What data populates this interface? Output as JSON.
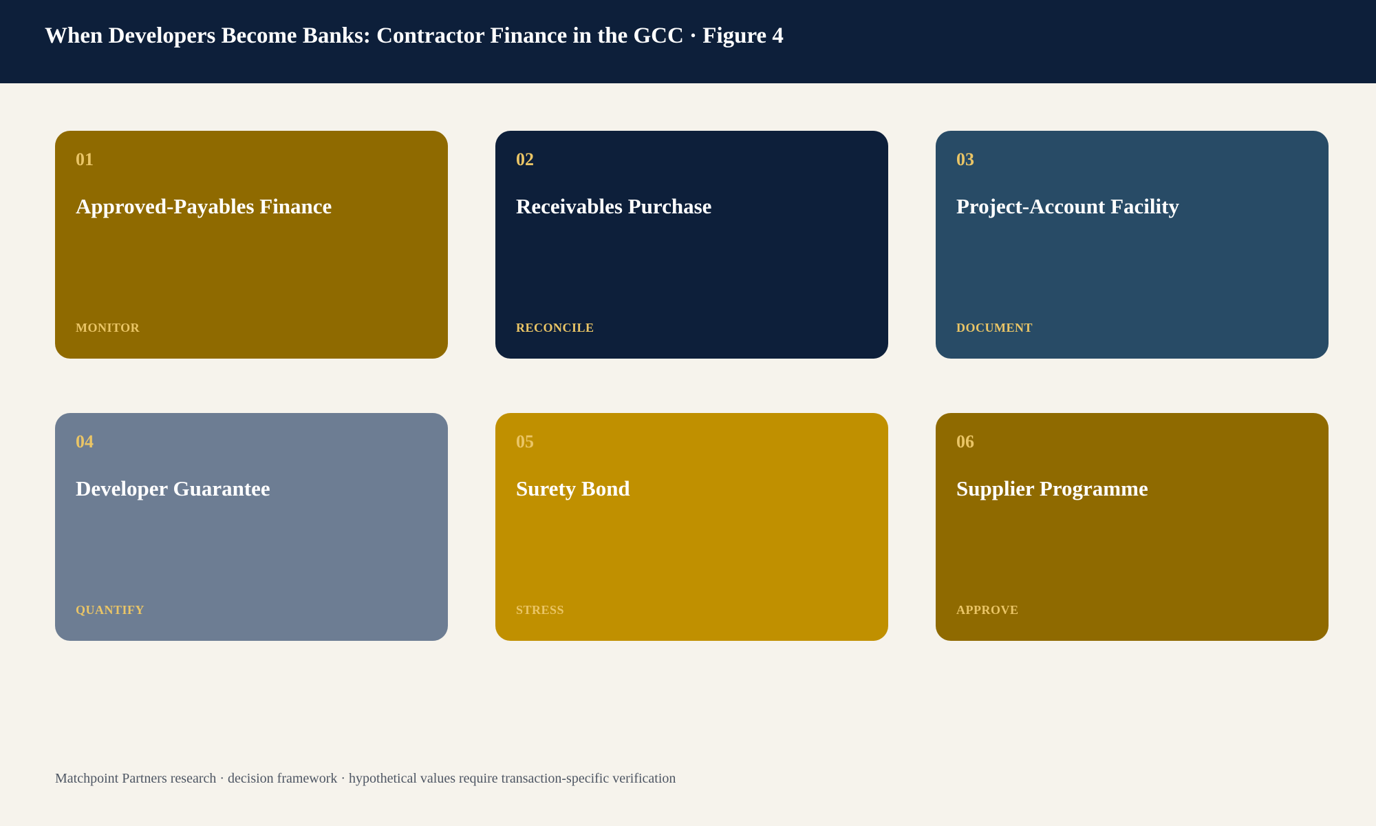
{
  "header": {
    "title": "When Developers Become Banks: Contractor Finance in the GCC · Figure 4",
    "background": "#0D1F3A"
  },
  "cards": [
    {
      "number": "01",
      "title": "Approved-Payables Finance",
      "tag": "MONITOR",
      "color": "#8F6A00"
    },
    {
      "number": "02",
      "title": "Receivables Purchase",
      "tag": "RECONCILE",
      "color": "#0D1F3A"
    },
    {
      "number": "03",
      "title": "Project-Account Facility",
      "tag": "DOCUMENT",
      "color": "#284B66"
    },
    {
      "number": "04",
      "title": "Developer Guarantee",
      "tag": "QUANTIFY",
      "color": "#6D7D93"
    },
    {
      "number": "05",
      "title": "Surety Bond",
      "tag": "STRESS",
      "color": "#C09000"
    },
    {
      "number": "06",
      "title": "Supplier Programme",
      "tag": "APPROVE",
      "color": "#8F6A00"
    }
  ],
  "accent_color": "#EAC566",
  "page_background": "#F6F3EC",
  "footer": {
    "note": "Matchpoint Partners research · decision framework · hypothetical values require transaction-specific verification"
  }
}
